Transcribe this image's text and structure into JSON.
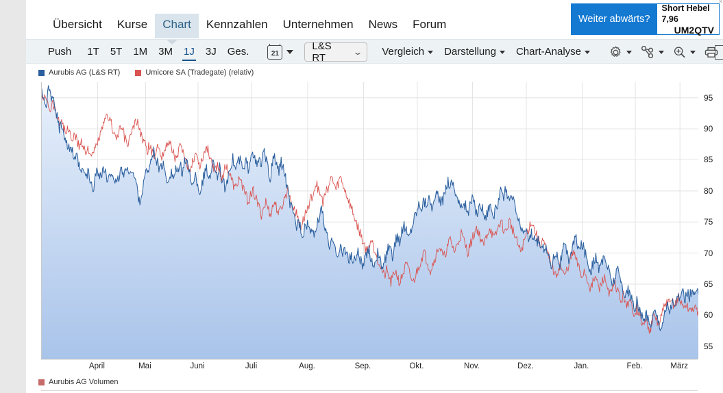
{
  "nav": {
    "items": [
      {
        "label": "Übersicht",
        "active": false
      },
      {
        "label": "Kurse",
        "active": false
      },
      {
        "label": "Chart",
        "active": true
      },
      {
        "label": "Kennzahlen",
        "active": false
      },
      {
        "label": "Unternehmen",
        "active": false
      },
      {
        "label": "News",
        "active": false
      },
      {
        "label": "Forum",
        "active": false
      }
    ]
  },
  "promo": {
    "headline": "Weiter abwärts?",
    "line1": "Short Hebel 7,96",
    "line2": "UM2QTV",
    "close": "×",
    "accent": "#1479d1"
  },
  "toolbar": {
    "push": "Push",
    "ranges": [
      {
        "label": "1T",
        "active": false
      },
      {
        "label": "5T",
        "active": false
      },
      {
        "label": "1M",
        "active": false
      },
      {
        "label": "3M",
        "active": false
      },
      {
        "label": "1J",
        "active": true
      },
      {
        "label": "3J",
        "active": false
      },
      {
        "label": "Ges.",
        "active": false
      }
    ],
    "calendar_icon": "calendar-icon",
    "calendar_day": "21",
    "source_select": {
      "value": "L&S RT",
      "chevron": "⌄"
    },
    "menus": [
      {
        "label": "Vergleich"
      },
      {
        "label": "Darstellung"
      },
      {
        "label": "Chart-Analyse"
      }
    ],
    "icons": [
      {
        "name": "gear-icon",
        "has_dropdown": true
      },
      {
        "name": "share-nodes-icon",
        "has_dropdown": true
      },
      {
        "name": "zoom-in-icon",
        "has_dropdown": true
      },
      {
        "name": "print-icon",
        "has_dropdown": false
      },
      {
        "name": "panel-icon",
        "has_dropdown": false
      }
    ]
  },
  "chart_legend": [
    {
      "label": "Aurubis AG (L&S RT)",
      "color": "#2b5f9e"
    },
    {
      "label": "Umicore SA (Tradegate) (relativ)",
      "color": "#d9534f"
    }
  ],
  "volume_legend": {
    "label": "Aurubis AG Volumen",
    "color": "#c76a6a"
  },
  "chart_data": {
    "type": "line",
    "title": "Aurubis AG (L&S RT)",
    "xlabel": "",
    "ylabel": "",
    "ylim": [
      53.0,
      97.5
    ],
    "yticks": [
      95,
      90,
      85,
      80,
      75,
      70,
      65,
      60,
      55
    ],
    "grid": true,
    "legend_position": "top-left",
    "categories": [
      "April",
      "Mai",
      "Juni",
      "Juli",
      "Aug.",
      "Sep.",
      "Okt.",
      "Nov.",
      "Dez.",
      "Jan.",
      "Feb.",
      "März"
    ],
    "xtick_fractions": [
      0.085,
      0.158,
      0.238,
      0.32,
      0.405,
      0.49,
      0.572,
      0.656,
      0.738,
      0.823,
      0.904,
      0.972
    ],
    "series": [
      {
        "name": "Aurubis AG (L&S RT)",
        "color": "#2b5f9e",
        "fill": true,
        "fill_gradient": [
          "#e8f0fb",
          "#a9c4ea"
        ],
        "values": [
          95.6,
          95.0,
          94.2,
          96.0,
          95.3,
          94.6,
          93.4,
          91.8,
          90.2,
          91.0,
          89.5,
          88.0,
          86.8,
          87.5,
          86.2,
          84.6,
          85.4,
          83.8,
          82.6,
          83.4,
          82.0,
          83.0,
          81.6,
          80.2,
          81.1,
          83.5,
          83.0,
          82.2,
          83.6,
          82.8,
          81.0,
          82.4,
          83.2,
          81.9,
          80.6,
          82.0,
          83.5,
          82.7,
          83.4,
          82.9,
          83.6,
          83.0,
          82.2,
          81.2,
          79.0,
          78.4,
          80.6,
          82.2,
          83.4,
          84.2,
          85.0,
          86.2,
          85.4,
          84.0,
          83.2,
          84.4,
          83.0,
          81.6,
          82.4,
          83.0,
          82.0,
          83.6,
          82.8,
          84.0,
          83.2,
          85.0,
          84.2,
          83.4,
          82.0,
          80.6,
          82.4,
          81.0,
          79.6,
          81.2,
          82.6,
          83.4,
          82.0,
          83.2,
          84.6,
          83.8,
          82.4,
          83.6,
          82.0,
          81.0,
          80.2,
          83.0,
          84.4,
          85.2,
          83.6,
          84.4,
          85.0,
          84.2,
          83.0,
          84.8,
          83.6,
          85.6,
          86.8,
          85.0,
          83.8,
          85.2,
          84.0,
          86.4,
          85.2,
          83.4,
          82.0,
          84.4,
          85.6,
          84.0,
          83.2,
          84.6,
          83.8,
          82.0,
          80.0,
          78.0,
          76.8,
          75.6,
          74.2,
          75.4,
          74.0,
          73.0,
          74.2,
          75.0,
          73.8,
          72.6,
          73.4,
          74.0,
          75.2,
          77.4,
          76.0,
          74.0,
          72.4,
          70.8,
          71.6,
          72.4,
          70.6,
          69.4,
          70.8,
          69.8,
          71.0,
          70.0,
          68.8,
          69.6,
          68.4,
          69.4,
          70.2,
          69.0,
          67.8,
          68.8,
          69.6,
          70.4,
          69.2,
          68.0,
          69.0,
          70.0,
          68.8,
          67.6,
          68.6,
          69.8,
          71.0,
          70.2,
          69.4,
          71.6,
          73.0,
          72.0,
          73.4,
          74.6,
          73.6,
          72.4,
          73.6,
          75.0,
          76.2,
          77.0,
          78.2,
          77.4,
          78.6,
          77.8,
          79.0,
          78.2,
          77.4,
          78.6,
          79.4,
          78.6,
          77.8,
          79.0,
          80.6,
          81.8,
          80.8,
          81.6,
          80.4,
          79.2,
          78.0,
          77.2,
          78.4,
          77.6,
          76.4,
          77.6,
          78.8,
          77.6,
          76.4,
          77.2,
          78.0,
          76.8,
          75.6,
          76.8,
          78.0,
          77.0,
          76.0,
          77.4,
          78.6,
          79.8,
          78.8,
          80.0,
          79.0,
          78.0,
          79.2,
          78.2,
          76.8,
          75.4,
          74.2,
          73.0,
          74.2,
          73.2,
          72.0,
          73.4,
          72.4,
          71.2,
          72.4,
          71.4,
          70.2,
          71.4,
          70.4,
          69.2,
          68.0,
          69.2,
          70.4,
          69.4,
          68.2,
          70.0,
          71.2,
          70.2,
          69.0,
          70.2,
          71.4,
          72.6,
          71.6,
          70.4,
          71.6,
          70.6,
          69.4,
          68.2,
          67.0,
          68.2,
          69.4,
          68.4,
          67.2,
          68.4,
          69.6,
          68.6,
          67.4,
          66.2,
          65.0,
          66.2,
          67.4,
          66.4,
          65.2,
          64.0,
          63.0,
          64.2,
          63.2,
          62.0,
          61.0,
          62.2,
          61.2,
          60.0,
          59.0,
          60.2,
          59.4,
          58.4,
          59.6,
          60.8,
          60.0,
          59.0,
          58.2,
          59.4,
          60.6,
          61.8,
          60.8,
          62.0,
          61.0,
          62.2,
          63.4,
          62.4,
          63.6,
          62.6,
          63.8,
          63.0,
          64.0,
          63.2,
          63.9,
          63.4
        ]
      },
      {
        "name": "Umicore SA (Tradegate) (relativ)",
        "color": "#d9534f",
        "fill": false,
        "values": [
          95.2,
          94.6,
          95.4,
          94.0,
          93.2,
          94.4,
          93.0,
          92.0,
          90.8,
          91.6,
          90.4,
          89.2,
          90.0,
          89.0,
          88.2,
          89.0,
          88.0,
          87.0,
          88.2,
          87.2,
          86.0,
          87.0,
          86.2,
          85.4,
          86.4,
          87.4,
          88.4,
          89.4,
          90.4,
          91.4,
          92.4,
          91.4,
          90.4,
          89.4,
          88.4,
          89.4,
          90.4,
          89.4,
          88.4,
          87.4,
          88.4,
          89.4,
          90.4,
          91.4,
          90.4,
          89.4,
          88.4,
          87.4,
          86.4,
          87.4,
          86.4,
          85.4,
          86.4,
          87.4,
          86.4,
          85.4,
          86.4,
          87.4,
          88.2,
          87.2,
          86.2,
          85.2,
          86.2,
          87.2,
          86.2,
          85.2,
          84.2,
          83.2,
          84.2,
          85.2,
          86.2,
          85.2,
          84.2,
          85.2,
          86.2,
          87.2,
          86.2,
          85.2,
          84.2,
          83.2,
          84.2,
          83.2,
          82.2,
          83.2,
          84.2,
          83.2,
          82.2,
          81.2,
          80.2,
          81.2,
          82.2,
          81.2,
          80.2,
          79.2,
          78.2,
          79.2,
          80.2,
          79.2,
          78.2,
          77.2,
          76.2,
          77.2,
          78.2,
          77.2,
          76.2,
          77.2,
          78.2,
          77.2,
          76.2,
          77.2,
          78.2,
          79.2,
          80.2,
          79.2,
          78.2,
          77.2,
          76.2,
          75.2,
          74.2,
          75.2,
          76.2,
          77.2,
          78.2,
          79.2,
          80.2,
          81.2,
          80.2,
          79.2,
          78.2,
          79.2,
          80.2,
          81.2,
          82.2,
          81.2,
          80.2,
          81.2,
          82.2,
          81.2,
          80.2,
          79.2,
          78.2,
          77.2,
          76.2,
          75.2,
          74.2,
          73.2,
          72.2,
          71.2,
          70.2,
          71.2,
          72.2,
          71.2,
          70.2,
          69.2,
          68.2,
          67.2,
          66.2,
          67.2,
          66.2,
          65.2,
          66.2,
          67.2,
          66.2,
          65.2,
          66.2,
          67.2,
          68.2,
          67.2,
          66.2,
          65.2,
          66.2,
          67.2,
          68.2,
          69.2,
          70.2,
          69.2,
          68.2,
          67.2,
          68.2,
          69.2,
          70.2,
          71.2,
          70.2,
          69.2,
          70.2,
          71.2,
          72.2,
          71.2,
          70.2,
          71.2,
          72.2,
          73.2,
          72.2,
          71.2,
          70.2,
          71.2,
          72.2,
          73.2,
          74.2,
          73.2,
          72.2,
          71.2,
          72.2,
          73.2,
          74.2,
          73.2,
          72.2,
          73.2,
          74.2,
          75.2,
          74.2,
          73.2,
          74.2,
          75.2,
          74.2,
          73.2,
          72.2,
          71.2,
          70.2,
          71.2,
          72.2,
          73.2,
          74.2,
          75.2,
          74.2,
          73.2,
          72.2,
          71.2,
          72.2,
          71.2,
          70.2,
          69.2,
          68.2,
          67.2,
          66.2,
          67.2,
          68.2,
          67.2,
          66.2,
          67.2,
          68.2,
          69.2,
          70.2,
          69.2,
          68.2,
          67.2,
          66.2,
          67.2,
          66.2,
          65.2,
          64.2,
          65.2,
          66.2,
          65.2,
          64.2,
          65.2,
          66.2,
          65.2,
          64.2,
          63.2,
          64.2,
          65.2,
          64.2,
          63.2,
          62.2,
          63.2,
          62.2,
          61.2,
          62.2,
          61.2,
          60.2,
          61.2,
          60.2,
          59.2,
          58.2,
          59.2,
          58.4,
          57.6,
          58.8,
          60.0,
          59.2,
          58.4,
          59.6,
          60.8,
          61.6,
          62.4,
          61.6,
          62.4,
          61.6,
          62.2,
          62.8,
          62.0,
          61.4,
          61.8,
          61.2,
          60.8,
          61.2,
          60.8,
          61.0,
          60.6
        ]
      }
    ]
  }
}
